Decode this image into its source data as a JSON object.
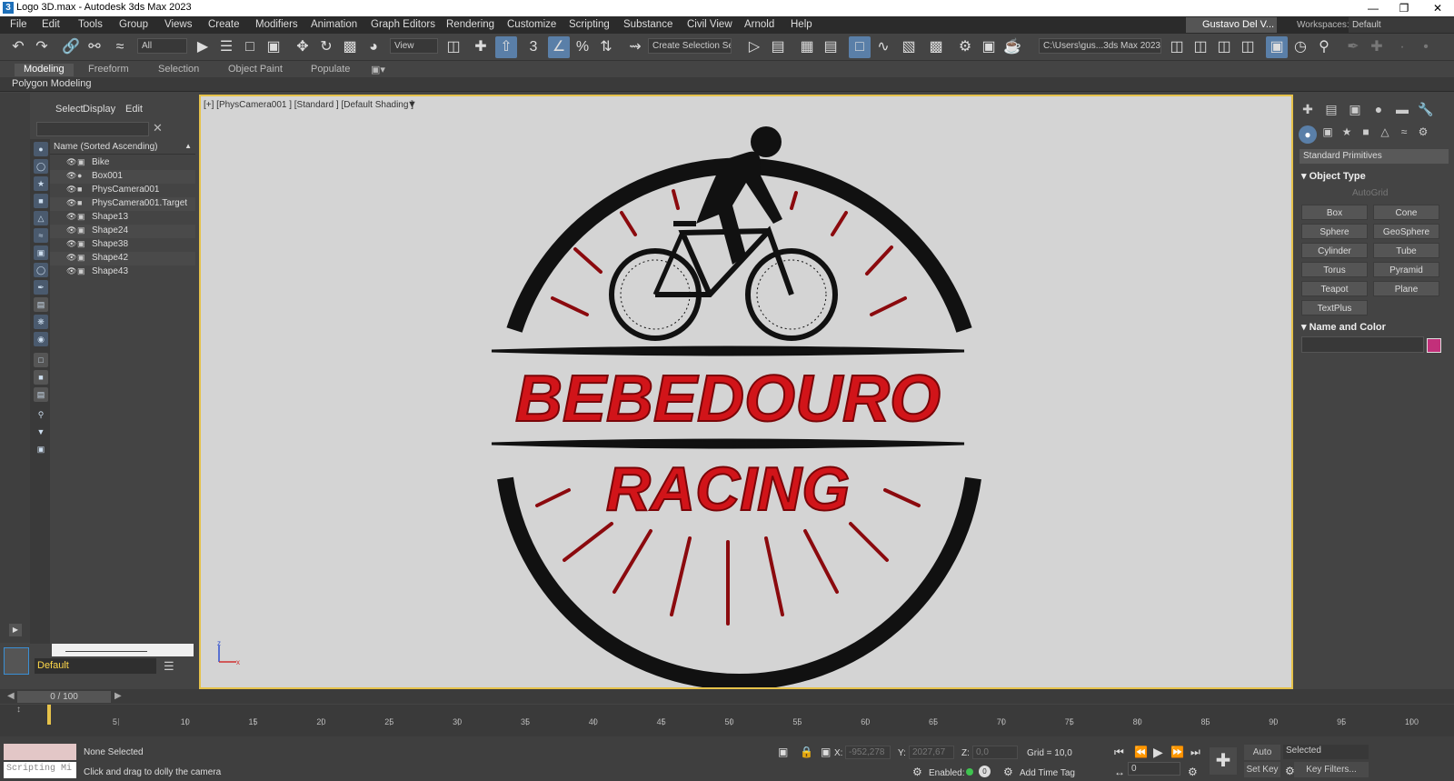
{
  "window": {
    "title": "Logo 3D.max - Autodesk 3ds Max 2023",
    "app_icon": "3"
  },
  "menu": [
    "File",
    "Edit",
    "Tools",
    "Group",
    "Views",
    "Create",
    "Modifiers",
    "Animation",
    "Graph Editors",
    "Rendering",
    "Customize",
    "Scripting",
    "Substance",
    "Civil View",
    "Arnold",
    "Help"
  ],
  "user": "Gustavo Del V...",
  "workspace": {
    "label": "Workspaces:",
    "value": "Default"
  },
  "toolbar": {
    "filter": "All",
    "ref_coord": "View",
    "selection_set": "Create Selection Se",
    "project_path": "C:\\Users\\gus...3ds Max 2023"
  },
  "ribbon_tabs": [
    "Modeling",
    "Freeform",
    "Selection",
    "Object Paint",
    "Populate"
  ],
  "ribbon_sub": "Polygon Modeling",
  "explorer": {
    "tabs": [
      "Select",
      "Display",
      "Edit"
    ],
    "header": "Name (Sorted Ascending)",
    "items": [
      "Bike",
      "Box001",
      "PhysCamera001",
      "PhysCamera001.Target",
      "Shape13",
      "Shape24",
      "Shape38",
      "Shape42",
      "Shape43"
    ]
  },
  "layer": "Default",
  "viewport": {
    "label": "[+] [PhysCamera001 ] [Standard ] [Default Shading ]",
    "logo_line1": "BEBEDOURO",
    "logo_line2": "RACING",
    "axis_z": "z",
    "axis_x": "x"
  },
  "command_panel": {
    "category": "Standard Primitives",
    "object_type": "Object Type",
    "autogrid": "AutoGrid",
    "primitives": [
      "Box",
      "Cone",
      "Sphere",
      "GeoSphere",
      "Cylinder",
      "Tube",
      "Torus",
      "Pyramid",
      "Teapot",
      "Plane",
      "TextPlus"
    ],
    "name_color": "Name and Color",
    "color": "#c2307a"
  },
  "timeline": {
    "slider": "0 / 100",
    "ticks": [
      5,
      10,
      15,
      20,
      25,
      30,
      35,
      40,
      45,
      50,
      55,
      60,
      65,
      70,
      75,
      80,
      85,
      90,
      95,
      100
    ]
  },
  "status": {
    "script_label": "Scripting Mi",
    "selection": "None Selected",
    "prompt": "Click and drag to dolly the camera",
    "x_label": "X:",
    "x": "-952,278",
    "y_label": "Y:",
    "y": "2027,67",
    "z_label": "Z:",
    "z": "0,0",
    "grid": "Grid = 10,0",
    "enabled": "Enabled:",
    "add_time_tag": "Add Time Tag",
    "auto_key": "Auto Key",
    "set_key": "Set Key",
    "key_selected": "Selected",
    "key_filters": "Key Filters...",
    "frame": "0"
  }
}
